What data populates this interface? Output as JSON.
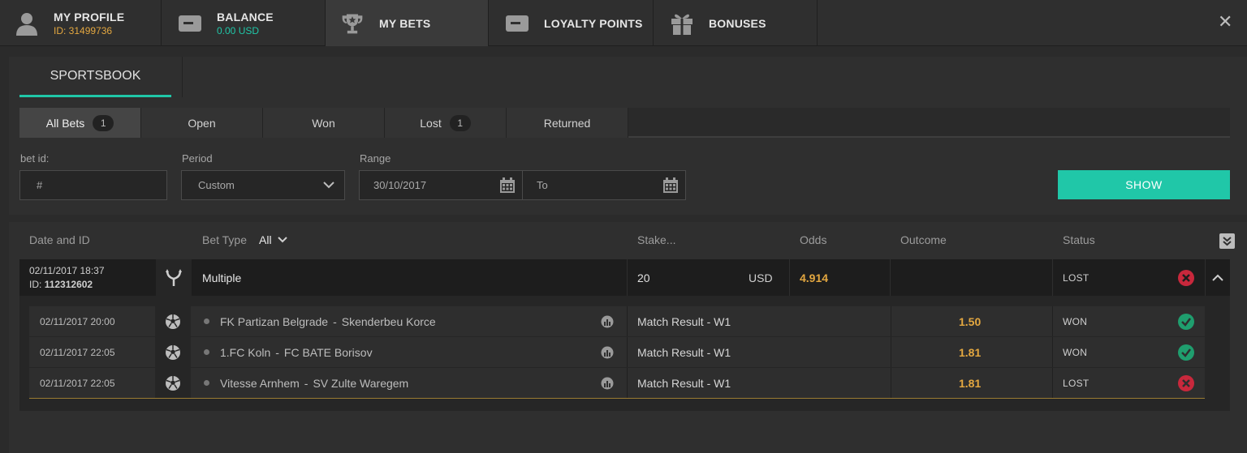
{
  "nav": {
    "profile": {
      "title": "MY PROFILE",
      "id_text": "ID: 31499736"
    },
    "balance": {
      "title": "BALANCE",
      "amount": "0.00 USD"
    },
    "my_bets": {
      "title": "MY BETS"
    },
    "loyalty": {
      "title": "LOYALTY POINTS"
    },
    "bonuses": {
      "title": "BONUSES"
    },
    "close": "✕"
  },
  "section_tab": "SPORTSBOOK",
  "filter_tabs": [
    {
      "label": "All Bets",
      "count": "1"
    },
    {
      "label": "Open",
      "count": ""
    },
    {
      "label": "Won",
      "count": ""
    },
    {
      "label": "Lost",
      "count": "1"
    },
    {
      "label": "Returned",
      "count": ""
    }
  ],
  "form": {
    "bet_id_label": "bet id:",
    "bet_id_placeholder": "#",
    "period_label": "Period",
    "period_value": "Custom",
    "range_label": "Range",
    "range_from": "30/10/2017",
    "range_to_placeholder": "To",
    "show_button": "SHOW"
  },
  "table": {
    "headers": {
      "date_id": "Date and ID",
      "bet_type": "Bet Type",
      "bet_type_filter": "All",
      "stake": "Stake...",
      "odds": "Odds",
      "outcome": "Outcome",
      "status": "Status"
    },
    "bet": {
      "datetime": "02/11/2017 18:37",
      "id_label": "ID:",
      "id_value": "112312602",
      "type": "Multiple",
      "stake": "20",
      "currency": "USD",
      "odds": "4.914",
      "outcome": "",
      "status": "LOST"
    },
    "legs": [
      {
        "datetime": "02/11/2017 20:00",
        "team1": "FK Partizan Belgrade",
        "team2": "Skenderbeu Korce",
        "separator": "-",
        "market": "Match Result - W1",
        "odds": "1.50",
        "status": "WON"
      },
      {
        "datetime": "02/11/2017 22:05",
        "team1": "1.FC Koln",
        "team2": "FC BATE Borisov",
        "separator": "-",
        "market": "Match Result - W1",
        "odds": "1.81",
        "status": "WON"
      },
      {
        "datetime": "02/11/2017 22:05",
        "team1": "Vitesse Arnhem",
        "team2": "SV Zulte Waregem",
        "separator": "-",
        "market": "Match Result - W1",
        "odds": "1.81",
        "status": "LOST"
      }
    ]
  },
  "colors": {
    "accent": "#20c7a8",
    "odds": "#e3a740",
    "profile_id": "#e3a740",
    "balance_amount": "#20c7a8",
    "won": "#1f9e6e",
    "lost": "#c8283c"
  }
}
